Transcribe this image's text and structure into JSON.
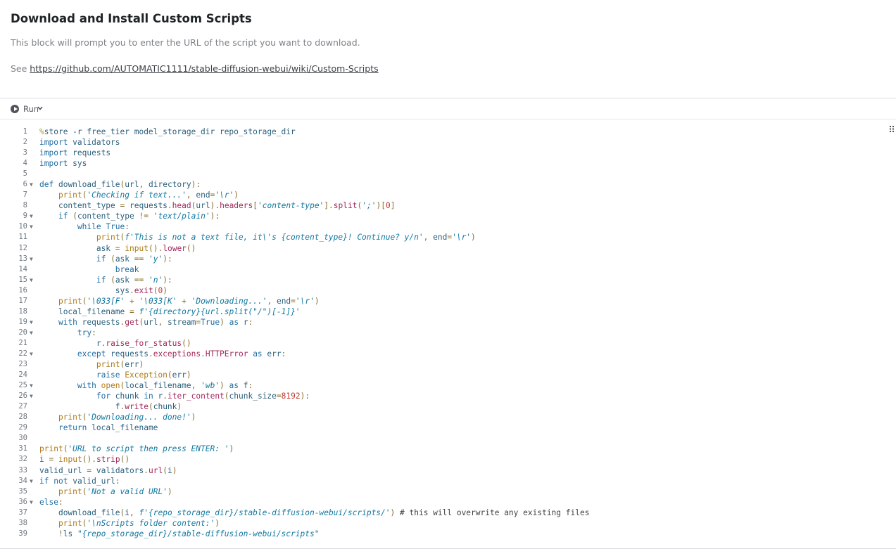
{
  "markdown": {
    "title": "Download and Install Custom Scripts",
    "description": "This block will prompt you to enter the URL of the script you want to download.",
    "see_prefix": "See ",
    "link_text": "https://github.com/AUTOMATIC1111/stable-diffusion-webui/wiki/Custom-Scripts"
  },
  "toolbar": {
    "run_label": "Run",
    "run_icon": "play-circle-icon",
    "dropdown_icon": "chevron-down-icon",
    "drag_icon": "drag-handle-icon"
  },
  "colors": {
    "keyword": "#1f6da3",
    "string": "#1278a0",
    "builtin": "#b07a1a",
    "line_number": "#6e7781"
  },
  "code": {
    "lines": [
      {
        "n": "1",
        "fold": false,
        "text": "%store -r free_tier model_storage_dir repo_storage_dir"
      },
      {
        "n": "2",
        "fold": false,
        "text": "import validators"
      },
      {
        "n": "3",
        "fold": false,
        "text": "import requests"
      },
      {
        "n": "4",
        "fold": false,
        "text": "import sys"
      },
      {
        "n": "5",
        "fold": false,
        "text": ""
      },
      {
        "n": "6",
        "fold": true,
        "text": "def download_file(url, directory):"
      },
      {
        "n": "7",
        "fold": false,
        "text": "    print('Checking if text...', end='\\r')"
      },
      {
        "n": "8",
        "fold": false,
        "text": "    content_type = requests.head(url).headers['content-type'].split(';')[0]"
      },
      {
        "n": "9",
        "fold": true,
        "text": "    if (content_type != 'text/plain'):"
      },
      {
        "n": "10",
        "fold": true,
        "text": "        while True:"
      },
      {
        "n": "11",
        "fold": false,
        "text": "            print(f'This is not a text file, it\\'s {content_type}! Continue? y/n', end='\\r')"
      },
      {
        "n": "12",
        "fold": false,
        "text": "            ask = input().lower()"
      },
      {
        "n": "13",
        "fold": true,
        "text": "            if (ask == 'y'):"
      },
      {
        "n": "14",
        "fold": false,
        "text": "                break"
      },
      {
        "n": "15",
        "fold": true,
        "text": "            if (ask == 'n'):"
      },
      {
        "n": "16",
        "fold": false,
        "text": "                sys.exit(0)"
      },
      {
        "n": "17",
        "fold": false,
        "text": "    print('\\033[F' + '\\033[K' + 'Downloading...', end='\\r')"
      },
      {
        "n": "18",
        "fold": false,
        "text": "    local_filename = f'{directory}{url.split(\"/\")[-1]}'"
      },
      {
        "n": "19",
        "fold": true,
        "text": "    with requests.get(url, stream=True) as r:"
      },
      {
        "n": "20",
        "fold": true,
        "text": "        try:"
      },
      {
        "n": "21",
        "fold": false,
        "text": "            r.raise_for_status()"
      },
      {
        "n": "22",
        "fold": true,
        "text": "        except requests.exceptions.HTTPError as err:"
      },
      {
        "n": "23",
        "fold": false,
        "text": "            print(err)"
      },
      {
        "n": "24",
        "fold": false,
        "text": "            raise Exception(err)"
      },
      {
        "n": "25",
        "fold": true,
        "text": "        with open(local_filename, 'wb') as f:"
      },
      {
        "n": "26",
        "fold": true,
        "text": "            for chunk in r.iter_content(chunk_size=8192):"
      },
      {
        "n": "27",
        "fold": false,
        "text": "                f.write(chunk)"
      },
      {
        "n": "28",
        "fold": false,
        "text": "    print('Downloading... done!')"
      },
      {
        "n": "29",
        "fold": false,
        "text": "    return local_filename"
      },
      {
        "n": "30",
        "fold": false,
        "text": ""
      },
      {
        "n": "31",
        "fold": false,
        "text": "print('URL to script then press ENTER: ')"
      },
      {
        "n": "32",
        "fold": false,
        "text": "i = input().strip()"
      },
      {
        "n": "33",
        "fold": false,
        "text": "valid_url = validators.url(i)"
      },
      {
        "n": "34",
        "fold": true,
        "text": "if not valid_url:"
      },
      {
        "n": "35",
        "fold": false,
        "text": "    print('Not a valid URL')"
      },
      {
        "n": "36",
        "fold": true,
        "text": "else:"
      },
      {
        "n": "37",
        "fold": false,
        "text": "    download_file(i, f'{repo_storage_dir}/stable-diffusion-webui/scripts/') # this will overwrite any existing files"
      },
      {
        "n": "38",
        "fold": false,
        "text": "    print('\\nScripts folder content:')"
      },
      {
        "n": "39",
        "fold": false,
        "text": "    !ls \"{repo_storage_dir}/stable-diffusion-webui/scripts\""
      }
    ]
  }
}
